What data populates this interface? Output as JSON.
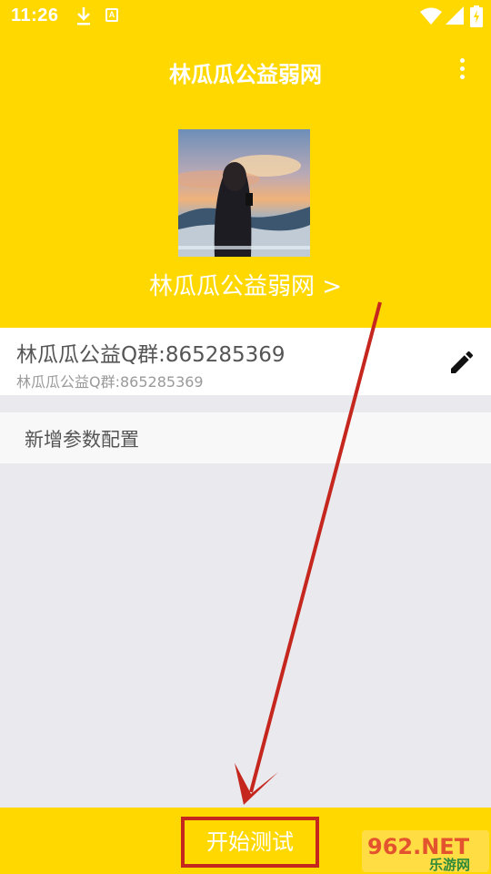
{
  "status_bar": {
    "time": "11:26",
    "notification_icons": [
      "download-icon",
      "a-box-icon"
    ],
    "system_icons": [
      "wifi-icon",
      "signal-icon",
      "battery-icon"
    ]
  },
  "header": {
    "title": "林瓜瓜公益弱网",
    "menu_icon": "more-vertical-icon",
    "profile_name": "林瓜瓜公益弱网 >"
  },
  "config": {
    "title": "林瓜瓜公益Q群:865285369",
    "subtitle": "林瓜瓜公益Q群:865285369",
    "edit_icon": "pencil-icon"
  },
  "add_config": {
    "label": "新增参数配置"
  },
  "bottom": {
    "start_label": "开始测试"
  },
  "watermark": {
    "brand": "962.NET",
    "site": "乐游网"
  },
  "colors": {
    "primary": "#ffd800",
    "background": "#e9e9ee",
    "annotation_red": "#c5261d"
  }
}
